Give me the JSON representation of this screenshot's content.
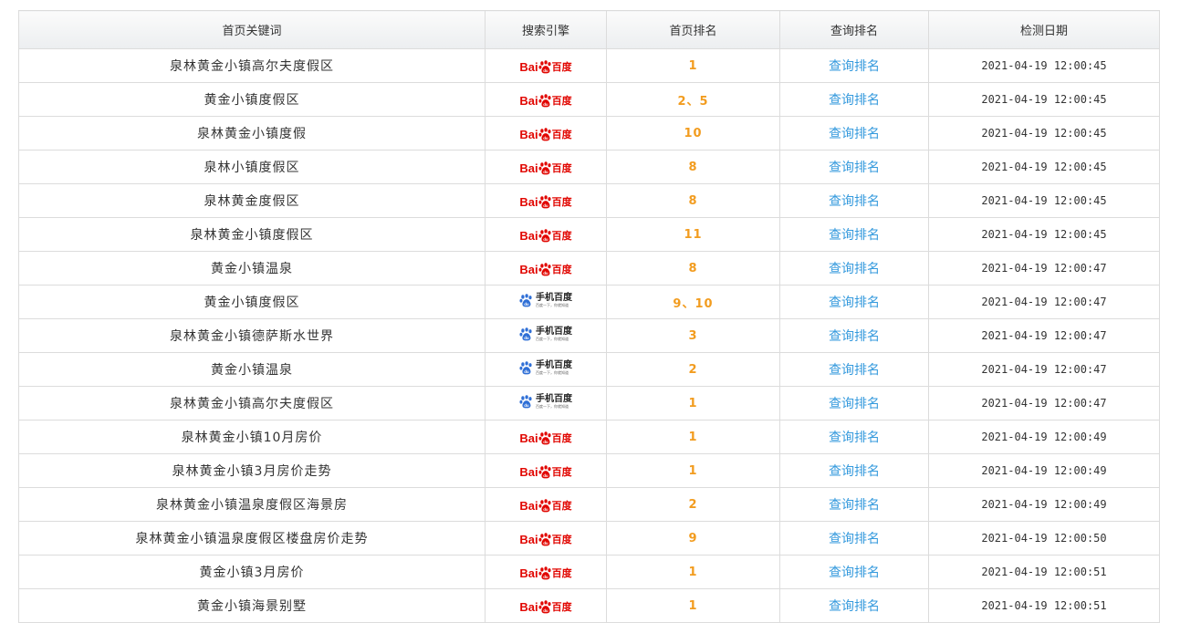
{
  "columns": [
    "首页关键词",
    "搜索引擎",
    "首页排名",
    "查询排名",
    "检测日期"
  ],
  "engines": {
    "baidu": {
      "name": "baidu",
      "text_en": "Bai",
      "text_cn": "百度",
      "icon": "baidu-paw-icon",
      "color": "#e10601"
    },
    "mobile": {
      "name": "mobile_baidu",
      "text": "手机百度",
      "subtext": "百度一下，你就知道",
      "icon": "baidu-paw-icon",
      "color": "#2f6fd6"
    }
  },
  "query_label": "查询排名",
  "rows": [
    {
      "keyword": "泉林黄金小镇高尔夫度假区",
      "engine": "baidu",
      "rank": "1",
      "date": "2021-04-19 12:00:45"
    },
    {
      "keyword": "黄金小镇度假区",
      "engine": "baidu",
      "rank": "2、5",
      "date": "2021-04-19 12:00:45"
    },
    {
      "keyword": "泉林黄金小镇度假",
      "engine": "baidu",
      "rank": "10",
      "date": "2021-04-19 12:00:45"
    },
    {
      "keyword": "泉林小镇度假区",
      "engine": "baidu",
      "rank": "8",
      "date": "2021-04-19 12:00:45"
    },
    {
      "keyword": "泉林黄金度假区",
      "engine": "baidu",
      "rank": "8",
      "date": "2021-04-19 12:00:45"
    },
    {
      "keyword": "泉林黄金小镇度假区",
      "engine": "baidu",
      "rank": "11",
      "date": "2021-04-19 12:00:45"
    },
    {
      "keyword": "黄金小镇温泉",
      "engine": "baidu",
      "rank": "8",
      "date": "2021-04-19 12:00:47"
    },
    {
      "keyword": "黄金小镇度假区",
      "engine": "mobile",
      "rank": "9、10",
      "date": "2021-04-19 12:00:47"
    },
    {
      "keyword": "泉林黄金小镇德萨斯水世界",
      "engine": "mobile",
      "rank": "3",
      "date": "2021-04-19 12:00:47"
    },
    {
      "keyword": "黄金小镇温泉",
      "engine": "mobile",
      "rank": "2",
      "date": "2021-04-19 12:00:47"
    },
    {
      "keyword": "泉林黄金小镇高尔夫度假区",
      "engine": "mobile",
      "rank": "1",
      "date": "2021-04-19 12:00:47"
    },
    {
      "keyword": "泉林黄金小镇10月房价",
      "engine": "baidu",
      "rank": "1",
      "date": "2021-04-19 12:00:49"
    },
    {
      "keyword": "泉林黄金小镇3月房价走势",
      "engine": "baidu",
      "rank": "1",
      "date": "2021-04-19 12:00:49"
    },
    {
      "keyword": "泉林黄金小镇温泉度假区海景房",
      "engine": "baidu",
      "rank": "2",
      "date": "2021-04-19 12:00:49"
    },
    {
      "keyword": "泉林黄金小镇温泉度假区楼盘房价走势",
      "engine": "baidu",
      "rank": "9",
      "date": "2021-04-19 12:00:50"
    },
    {
      "keyword": "黄金小镇3月房价",
      "engine": "baidu",
      "rank": "1",
      "date": "2021-04-19 12:00:51"
    },
    {
      "keyword": "黄金小镇海景别墅",
      "engine": "baidu",
      "rank": "1",
      "date": "2021-04-19 12:00:51"
    }
  ]
}
